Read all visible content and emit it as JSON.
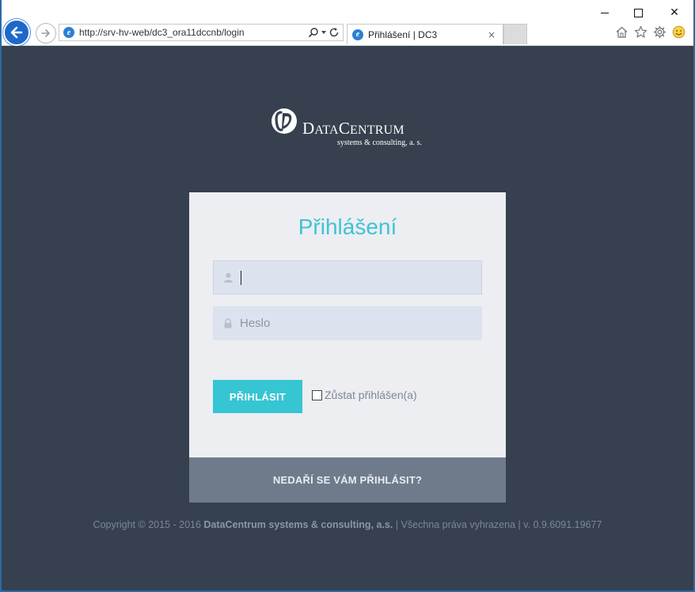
{
  "browser": {
    "url": "http://srv-hv-web/dc3_ora11dccnb/login",
    "tab_title": "Přihlášení | DC3",
    "tab_close": "×",
    "win_close": "✕"
  },
  "brand": {
    "name_large_1": "D",
    "name_small_1": "ATA",
    "name_large_2": "C",
    "name_small_2": "ENTRUM",
    "subtitle": "systems & consulting, a. s."
  },
  "login": {
    "title": "Přihlášení",
    "username_placeholder": "",
    "password_placeholder": "Heslo",
    "submit_label": "PŘIHLÁSIT",
    "remember_label": "Zůstat přihlášen(a)",
    "help_label": "NEDAŘÍ SE VÁM PŘIHLÁSIT?"
  },
  "footer": {
    "prefix": "Copyright © 2015 - 2016 ",
    "company": "DataCentrum systems & consulting, a.s.",
    "suffix": " | Všechna práva vyhrazena | v. 0.9.6091.19677"
  },
  "colors": {
    "page_bg": "#36404e",
    "accent": "#36c5d2",
    "card_bg": "#eceef2",
    "help_bar": "#6f7b8b"
  },
  "icons": {
    "back": "back-arrow-icon",
    "forward": "forward-arrow-icon",
    "search": "search-icon",
    "refresh": "refresh-icon",
    "home": "home-icon",
    "favorites": "star-icon",
    "settings": "gear-icon",
    "feedback": "smiley-icon",
    "user": "user-icon",
    "lock": "lock-icon"
  }
}
